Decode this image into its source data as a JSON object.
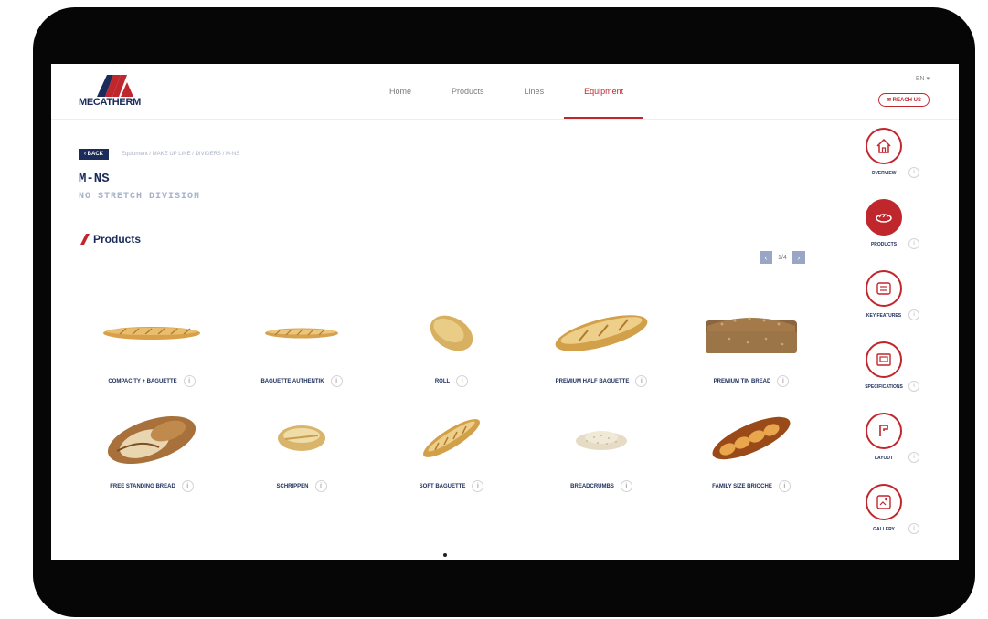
{
  "brand": {
    "name": "MECATHERM",
    "logo_color": "#c0272d",
    "logo_accent": "#1c2c5a"
  },
  "nav": {
    "items": [
      {
        "label": "Home"
      },
      {
        "label": "Products"
      },
      {
        "label": "Lines"
      },
      {
        "label": "Equipment",
        "active": true
      }
    ]
  },
  "header": {
    "language": "EN ▾",
    "cta_label": "✉ REACH US"
  },
  "breadcrumb": {
    "back_label": "‹ BACK",
    "path": "Equipment / MAKE UP LINE / DIVIDERS / M-NS"
  },
  "page": {
    "title": "M-NS",
    "subtitle": "NO STRETCH DIVISION"
  },
  "section": {
    "title": "Products"
  },
  "pager": {
    "prev": "‹",
    "label": "1/4",
    "next": "›"
  },
  "products": [
    {
      "label": "COMPACITY + BAGUETTE",
      "icon": "baguette"
    },
    {
      "label": "BAGUETTE AUTHENTIK",
      "icon": "thin-baguette"
    },
    {
      "label": "ROLL",
      "icon": "roll"
    },
    {
      "label": "PREMIUM HALF BAGUETTE",
      "icon": "half-baguette"
    },
    {
      "label": "PREMIUM TIN BREAD",
      "icon": "tin-bread"
    },
    {
      "label": "FREE STANDING BREAD",
      "icon": "free-bread"
    },
    {
      "label": "SCHRIPPEN",
      "icon": "schrippen"
    },
    {
      "label": "SOFT BAGUETTE",
      "icon": "soft-baguette"
    },
    {
      "label": "BREADCRUMBS",
      "icon": "breadcrumbs"
    },
    {
      "label": "FAMILY SIZE BRIOCHE",
      "icon": "brioche"
    }
  ],
  "sidebar": {
    "items": [
      {
        "label": "OVERVIEW",
        "icon": "home-icon"
      },
      {
        "label": "PRODUCTS",
        "icon": "bread-icon",
        "active": true
      },
      {
        "label": "KEY FEATURES",
        "icon": "features-icon"
      },
      {
        "label": "SPECIFICATIONS",
        "icon": "specs-icon"
      },
      {
        "label": "LAYOUT",
        "icon": "layout-icon"
      },
      {
        "label": "GALLERY",
        "icon": "gallery-icon"
      }
    ]
  },
  "info_glyph": "i",
  "colors": {
    "accent": "#c0272d",
    "navy": "#1c2c5a",
    "muted": "#a6b2c9"
  }
}
